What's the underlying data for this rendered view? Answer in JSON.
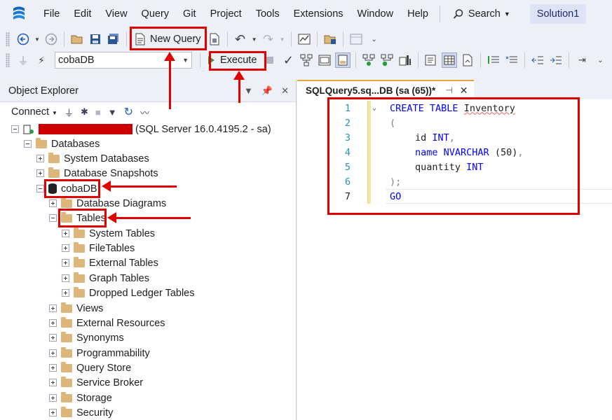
{
  "menu": {
    "items": [
      "File",
      "Edit",
      "View",
      "Query",
      "Git",
      "Project",
      "Tools",
      "Extensions",
      "Window",
      "Help"
    ],
    "search_label": "Search",
    "solution_label": "Solution1"
  },
  "toolbar": {
    "new_query_label": "New Query",
    "database_value": "cobaDB",
    "execute_label": "Execute"
  },
  "object_explorer": {
    "title": "Object Explorer",
    "connect_label": "Connect",
    "server_suffix": "(SQL Server 16.0.4195.2 - sa)",
    "databases_label": "Databases",
    "system_databases_label": "System Databases",
    "snapshots_label": "Database Snapshots",
    "db_name": "cobaDB",
    "diagrams_label": "Database Diagrams",
    "tables_label": "Tables",
    "table_children": [
      "System Tables",
      "FileTables",
      "External Tables",
      "Graph Tables",
      "Dropped Ledger Tables"
    ],
    "db_children": [
      "Views",
      "External Resources",
      "Synonyms",
      "Programmability",
      "Query Store",
      "Service Broker",
      "Storage",
      "Security"
    ]
  },
  "editor": {
    "tab_title": "SQLQuery5.sq...DB (sa (65))*",
    "line_numbers": [
      "1",
      "2",
      "3",
      "4",
      "5",
      "6",
      "7"
    ],
    "code": {
      "l1_kw": "CREATE TABLE",
      "l1_name": "Inventory",
      "l2": "(",
      "l3_name": "id",
      "l3_type": "INT",
      "l3_punct": ",",
      "l4_name": "name",
      "l4_type": "NVARCHAR",
      "l4_args": "(50)",
      "l4_punct": ",",
      "l5_name": "quantity",
      "l5_type": "INT",
      "l6": ");",
      "l7": "GO"
    }
  },
  "colors": {
    "annotation": "#e00000",
    "keyword": "#0000ff",
    "line_number": "#2b91af",
    "redaction": "#cc0000"
  }
}
